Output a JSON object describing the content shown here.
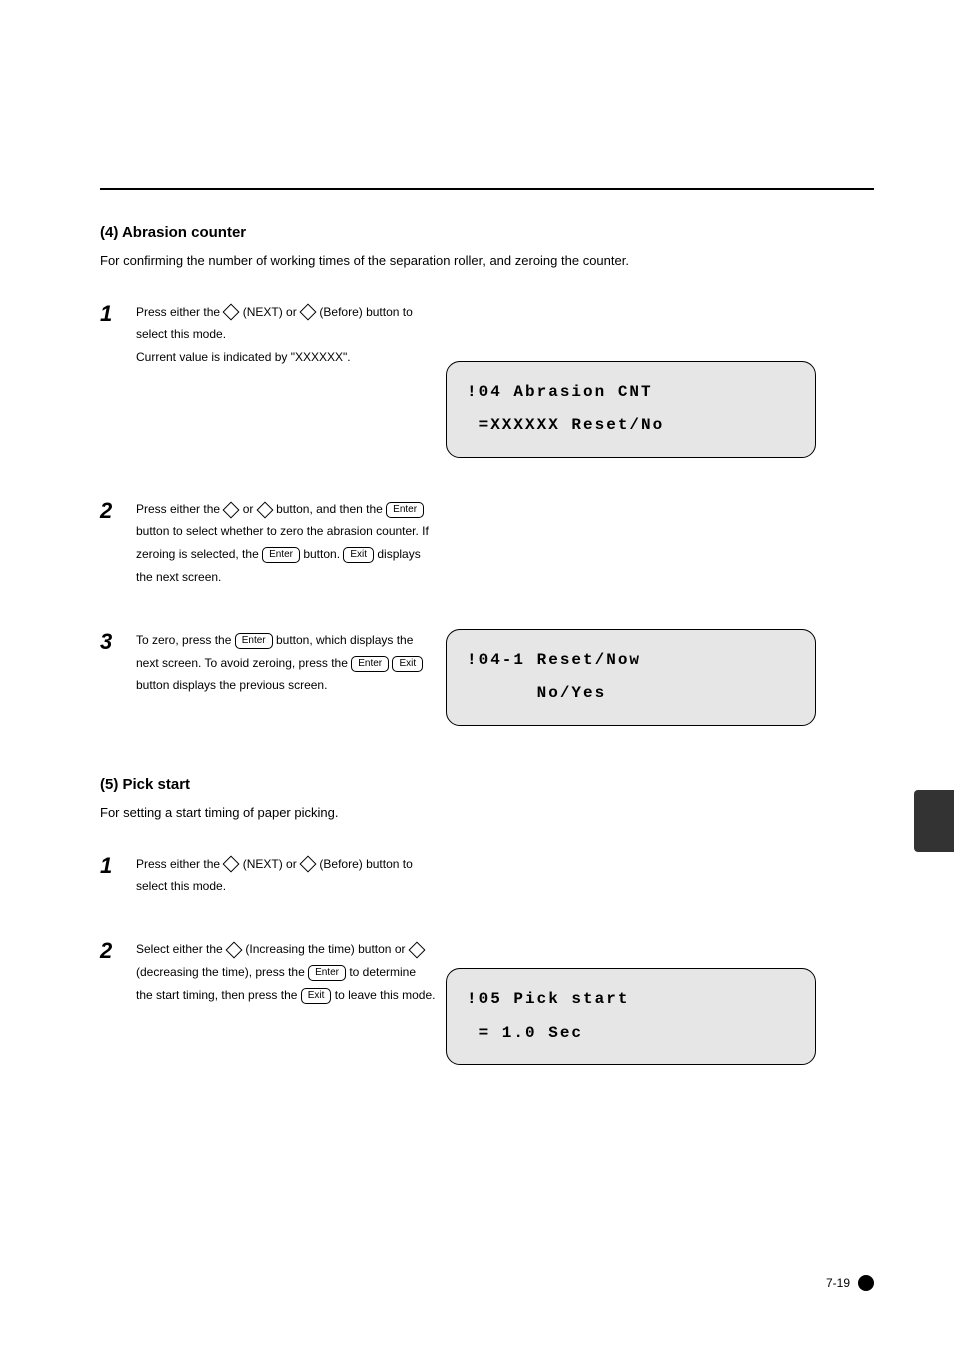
{
  "sectionA": {
    "title": "(4) Abrasion counter",
    "subtitle": "For confirming the number of working times of the separation roller, and zeroing the counter."
  },
  "sectionA_steps": {
    "s1": {
      "num": "1",
      "before_diamond": "Press either the ",
      "mid": " (NEXT) or ",
      "after": " (Before) button to select this mode.",
      "line2_prefix": "Current value is indicated by \"XXXXXX\"."
    },
    "s2": {
      "num": "2",
      "before": "Press either the ",
      "mid": " or ",
      "after": " button, and then the ",
      "btn_enter": "Enter",
      "after2": " button to select whether to zero the abrasion counter. If zeroing is selected, the ",
      "after3": " button. ",
      "btn_exit": "Exit",
      "after4": " displays the next screen."
    },
    "s3": {
      "num": "3",
      "before": "To zero, press the ",
      "btn_enter": "Enter",
      "after": " button, which displays the next screen. To avoid zeroing, press the ",
      "btn_exit": "Exit",
      "after2": " button displays the previous screen."
    }
  },
  "lcdA1": {
    "line1": "!04 Abrasion CNT",
    "line2": " =XXXXXX Reset/No"
  },
  "lcdA2": {
    "line1": "!04-1 Reset/Now",
    "line2": "      No/Yes"
  },
  "sectionB": {
    "title": "(5) Pick start",
    "subtitle": "For setting a start timing of paper picking."
  },
  "sectionB_steps": {
    "s1": {
      "num": "1",
      "before": "Press either the ",
      "mid": " (NEXT) or ",
      "after": " (Before) button to select this mode."
    },
    "s2": {
      "num": "2",
      "before": "Select either the ",
      "after1": " (Increasing the time) button or ",
      "after2": " (decreasing the time), press the ",
      "btn_enter": "Enter",
      "after3": " to determine the start timing, then press the ",
      "btn_exit": "Exit",
      "after4": " to leave this mode."
    }
  },
  "lcdB": {
    "line1": "!05 Pick start",
    "line2": " = 1.0 Sec"
  },
  "footer": {
    "page": "7-19"
  }
}
